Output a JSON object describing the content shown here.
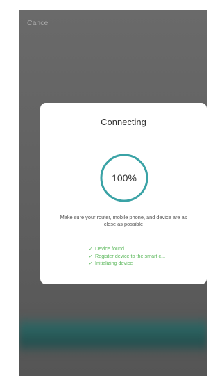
{
  "header": {
    "cancel_label": "Cancel"
  },
  "dialog": {
    "title": "Connecting",
    "progress_text": "100%",
    "progress_fraction": 1.0,
    "hint": "Make sure your router, mobile phone, and device are as close as possible",
    "steps": [
      {
        "label": "Device found",
        "icon": "check-icon"
      },
      {
        "label": "Register device to the smart c...",
        "icon": "check-icon"
      },
      {
        "label": "Initializing device",
        "icon": "check-icon"
      }
    ]
  },
  "colors": {
    "accent": "#3aa3a6",
    "success": "#5cb85c",
    "overlay": "#5f5f5f",
    "bottom_bar": "#2c6462"
  }
}
